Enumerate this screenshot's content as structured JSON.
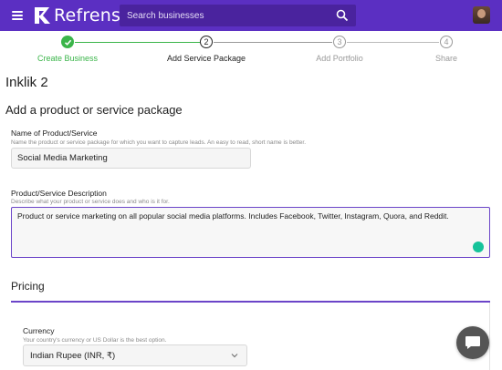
{
  "header": {
    "logo_text": "Refrens",
    "search_placeholder": "Search businesses"
  },
  "stepper": {
    "steps": [
      {
        "number": "",
        "label": "Create Business",
        "state": "completed"
      },
      {
        "number": "2",
        "label": "Add Service Package",
        "state": "active"
      },
      {
        "number": "3",
        "label": "Add Portfolio",
        "state": "pending"
      },
      {
        "number": "4",
        "label": "Share",
        "state": "pending"
      }
    ]
  },
  "page": {
    "title": "Inklik 2",
    "section_title": "Add a product or service package"
  },
  "form": {
    "name_label": "Name of Product/Service",
    "name_help": "Name the product or service package for which you want to capture leads. An easy to read, short name is better.",
    "name_value": "Social Media Marketing",
    "desc_label": "Product/Service Description",
    "desc_help": "Describe what your product or service does and who is it for.",
    "desc_value": "Product or service marketing on all popular social media platforms. Includes Facebook, Twitter, Instagram, Quora, and Reddit."
  },
  "pricing": {
    "title": "Pricing",
    "currency_label": "Currency",
    "currency_help": "Your country's currency or US Dollar is the best option.",
    "currency_value": "Indian Rupee (INR, ₹)"
  },
  "colors": {
    "brand": "#5b2fc2",
    "accent": "#6b44c8",
    "success": "#3bb54a"
  }
}
